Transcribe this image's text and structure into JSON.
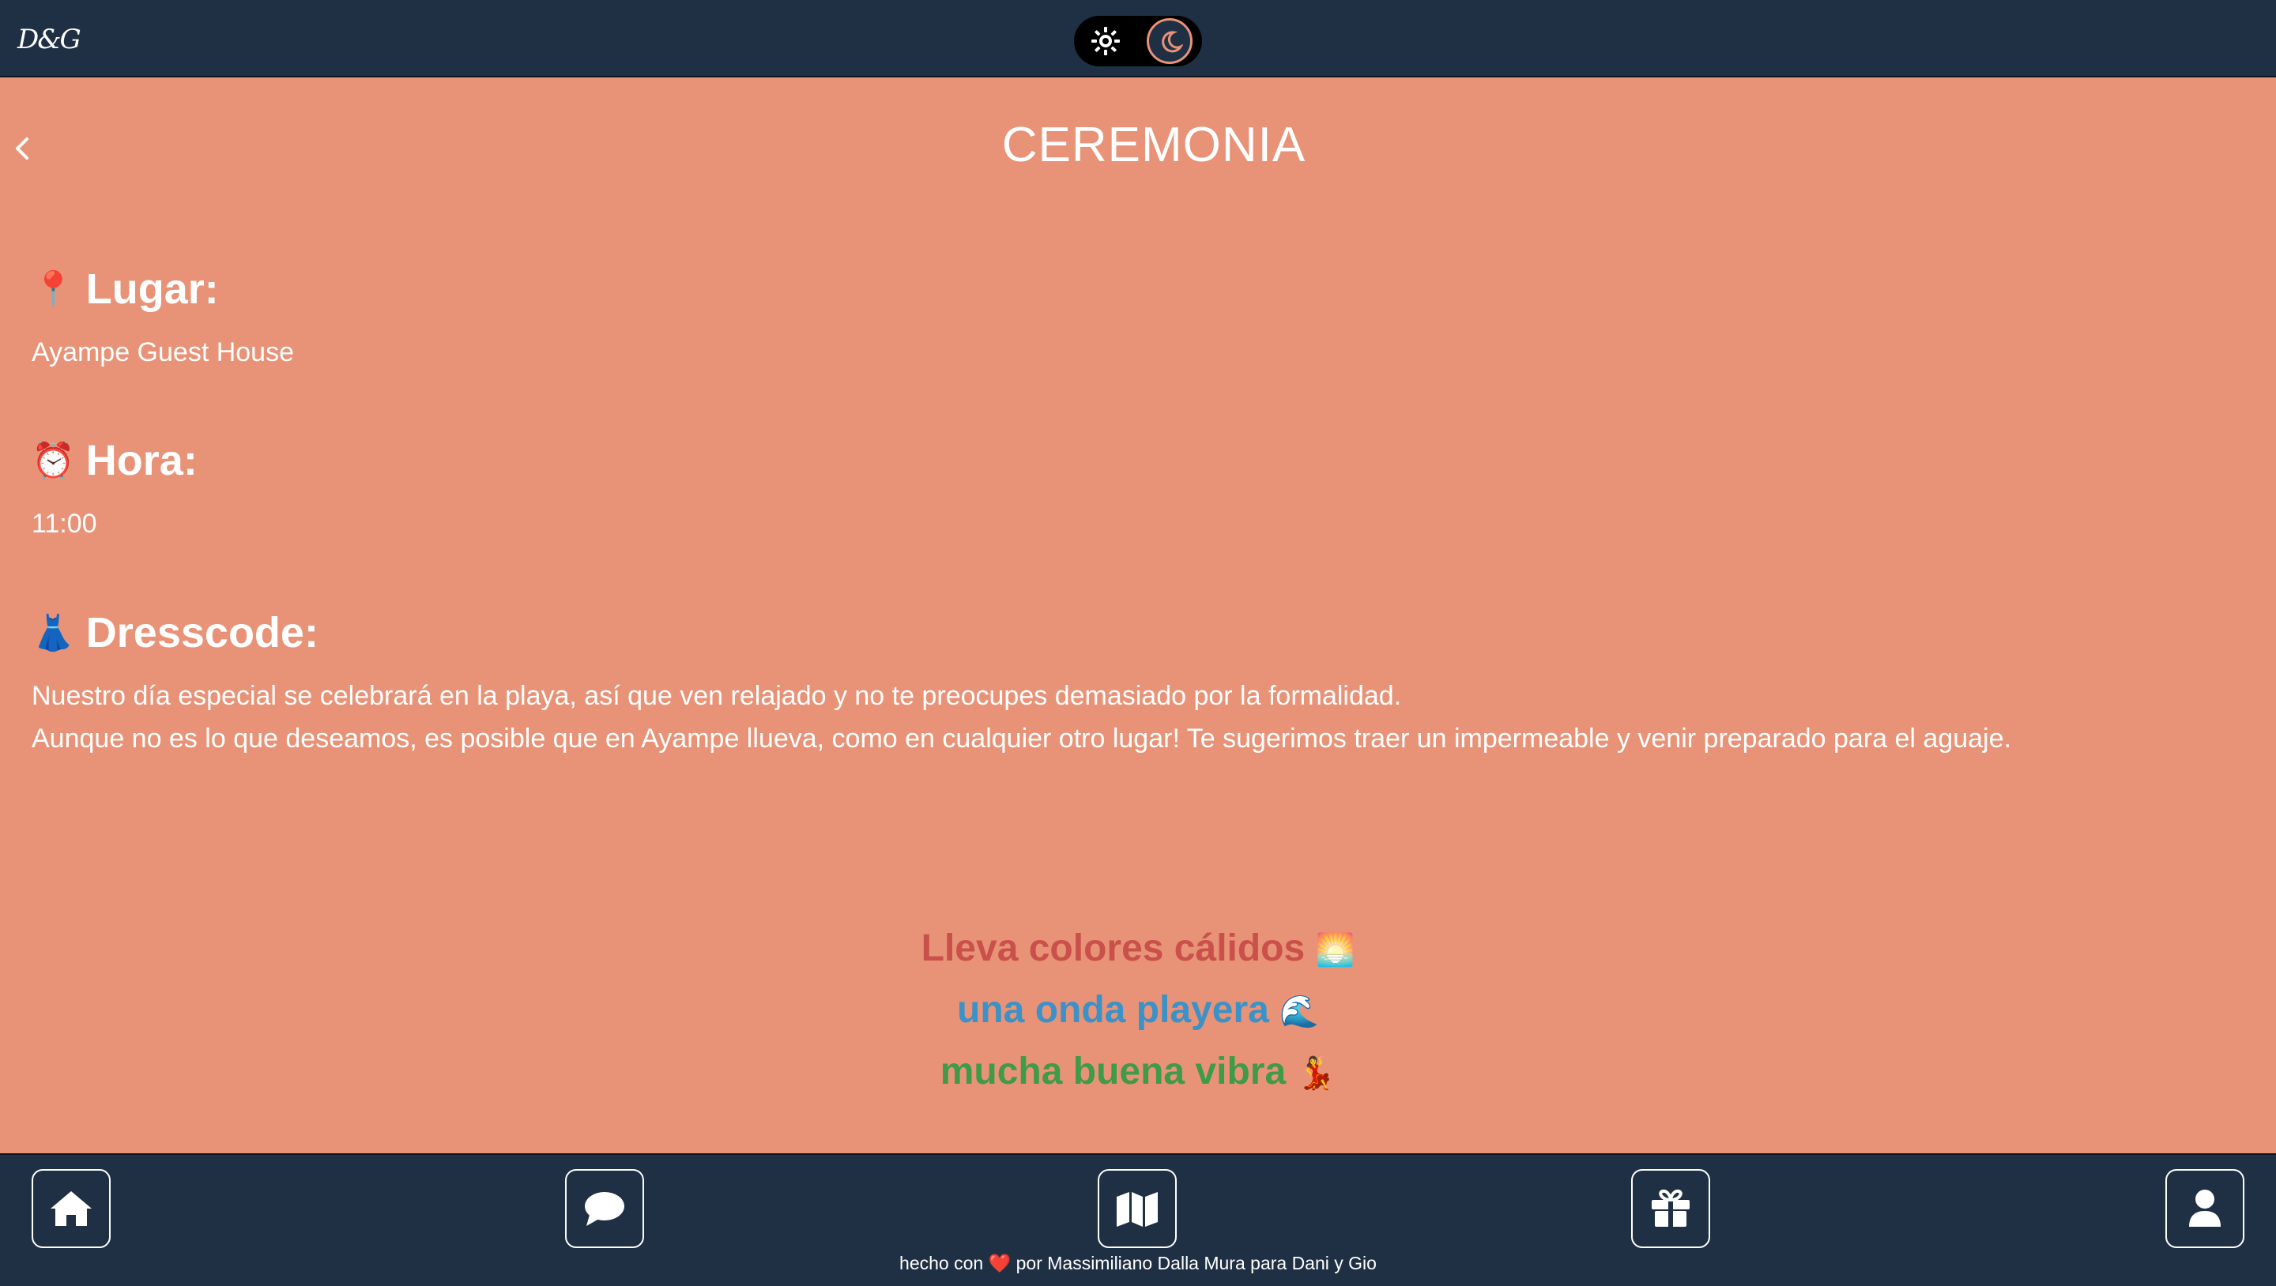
{
  "header": {
    "logo": "D&G",
    "theme_toggle": {
      "light_icon": "sun-icon",
      "dark_icon": "moon-icon",
      "selected": "dark"
    }
  },
  "page": {
    "title": "CEREMONIA",
    "back_icon": "chevron-left-icon"
  },
  "sections": {
    "lugar": {
      "emoji": "📍",
      "heading": "Lugar:",
      "text": "Ayampe Guest House"
    },
    "hora": {
      "emoji": "⏰",
      "heading": "Hora:",
      "text": "11:00"
    },
    "dresscode": {
      "emoji": "👗",
      "heading": "Dresscode:",
      "line1": "Nuestro día especial se celebrará en la playa, así que ven relajado y no te preocupes demasiado por la formalidad.",
      "line2": "Aunque no es lo que deseamos, es posible que en Ayampe llueva, como en cualquier otro lugar! Te sugerimos traer un impermeable y venir preparado para el aguaje."
    }
  },
  "taglines": [
    {
      "text": "Lleva colores cálidos",
      "emoji": "🌅",
      "color": "#c9504b"
    },
    {
      "text": "una onda playera",
      "emoji": "🌊",
      "color": "#3a92c8"
    },
    {
      "text": "mucha buena vibra",
      "emoji": "💃",
      "color": "#3f9b49"
    }
  ],
  "bottom_nav": {
    "items": [
      {
        "icon": "home-icon"
      },
      {
        "icon": "chat-icon"
      },
      {
        "icon": "map-icon"
      },
      {
        "icon": "gift-icon"
      },
      {
        "icon": "user-icon"
      }
    ],
    "credit_prefix": "hecho con",
    "credit_heart": "❤️",
    "credit_suffix": "por Massimiliano Dalla Mura para Dani y Gio"
  },
  "colors": {
    "background": "#e89377",
    "bar": "#1f3044"
  }
}
